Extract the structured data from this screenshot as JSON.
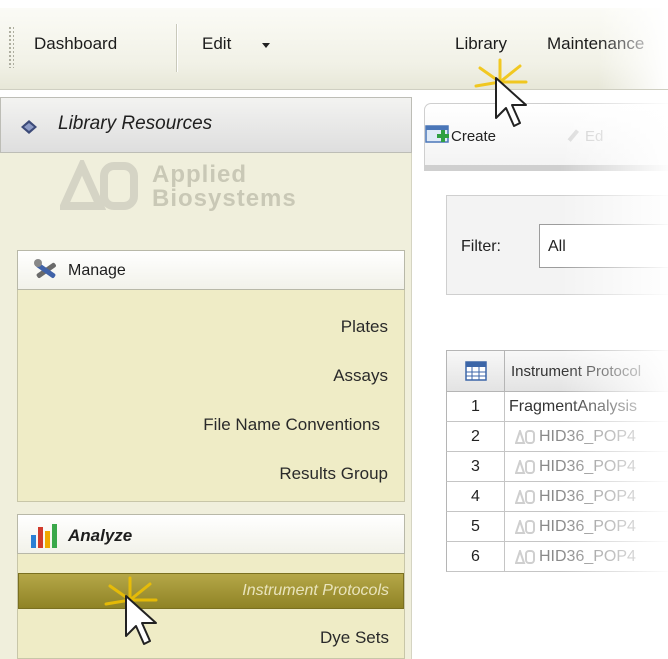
{
  "menubar": {
    "items": [
      {
        "label": "Dashboard"
      },
      {
        "label": "Edit"
      },
      {
        "label": "Library"
      },
      {
        "label": "Maintenance"
      }
    ]
  },
  "left_pane": {
    "library_title": "Library Resources",
    "logo_text": [
      "Applied",
      "Biosystems"
    ],
    "manage": {
      "label": "Manage",
      "items": [
        "Plates",
        "Assays",
        "File Name Conventions",
        "Results Group"
      ]
    },
    "analyze": {
      "label": "Analyze",
      "selected": "Instrument Protocols",
      "items": [
        "Dye Sets"
      ]
    }
  },
  "right_pane": {
    "toolbar": {
      "create_label": "Create",
      "next_label": "Ed"
    },
    "filter": {
      "label": "Filter:",
      "value": "All"
    },
    "grid": {
      "header": "Instrument Protocol",
      "rows": [
        {
          "num": "1",
          "name": "FragmentAnalysis"
        },
        {
          "num": "2",
          "name": "HID36_POP4"
        },
        {
          "num": "3",
          "name": "HID36_POP4"
        },
        {
          "num": "4",
          "name": "HID36_POP4"
        },
        {
          "num": "5",
          "name": "HID36_POP4"
        },
        {
          "num": "6",
          "name": "HID36_POP4"
        }
      ]
    }
  },
  "colors": {
    "nav_background": "#efecc6",
    "selected_item": "#9f922f",
    "cursor_highlight": "#f2c200"
  }
}
